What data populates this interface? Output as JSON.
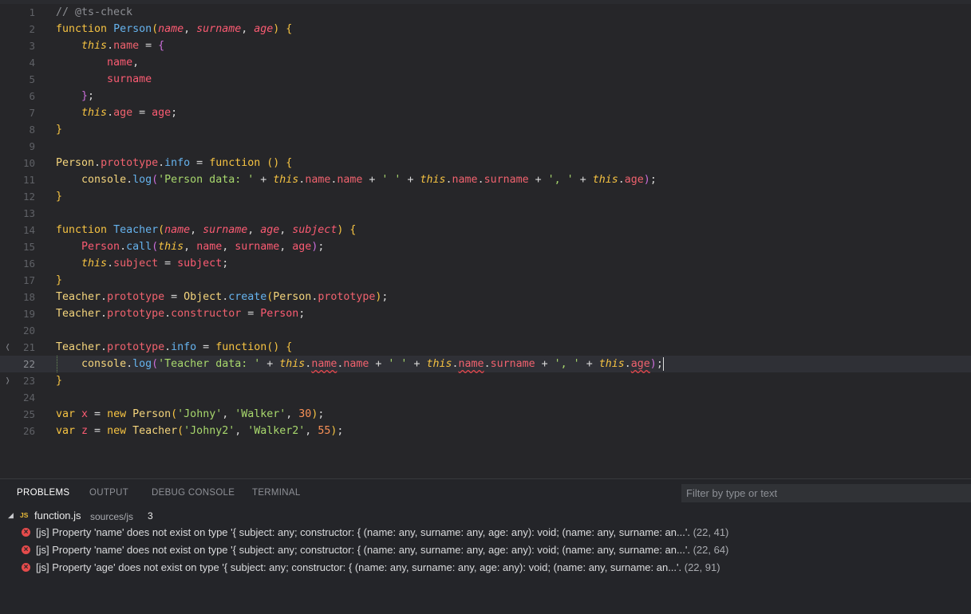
{
  "editor": {
    "lines": [
      {
        "num": "1",
        "tokens": [
          [
            "comment",
            "// @ts-check"
          ]
        ]
      },
      {
        "num": "2",
        "tokens": [
          [
            "kw",
            "function "
          ],
          [
            "fn",
            "Person"
          ],
          [
            "brace",
            "("
          ],
          [
            "param",
            "name"
          ],
          [
            "pun",
            ", "
          ],
          [
            "param",
            "surname"
          ],
          [
            "pun",
            ", "
          ],
          [
            "param",
            "age"
          ],
          [
            "brace",
            ")"
          ],
          [
            "pun",
            " "
          ],
          [
            "brace",
            "{"
          ]
        ]
      },
      {
        "num": "3",
        "tokens": [
          [
            "pun",
            "    "
          ],
          [
            "this",
            "this"
          ],
          [
            "pun",
            "."
          ],
          [
            "prop",
            "name"
          ],
          [
            "pun",
            " = "
          ],
          [
            "brace2",
            "{"
          ]
        ]
      },
      {
        "num": "4",
        "tokens": [
          [
            "pun",
            "        "
          ],
          [
            "var",
            "name"
          ],
          [
            "pun",
            ","
          ]
        ]
      },
      {
        "num": "5",
        "tokens": [
          [
            "pun",
            "        "
          ],
          [
            "var",
            "surname"
          ]
        ]
      },
      {
        "num": "6",
        "tokens": [
          [
            "pun",
            "    "
          ],
          [
            "brace2",
            "}"
          ],
          [
            "pun",
            ";"
          ]
        ]
      },
      {
        "num": "7",
        "tokens": [
          [
            "pun",
            "    "
          ],
          [
            "this",
            "this"
          ],
          [
            "pun",
            "."
          ],
          [
            "prop",
            "age"
          ],
          [
            "pun",
            " = "
          ],
          [
            "var",
            "age"
          ],
          [
            "pun",
            ";"
          ]
        ]
      },
      {
        "num": "8",
        "tokens": [
          [
            "brace",
            "}"
          ]
        ]
      },
      {
        "num": "9",
        "tokens": []
      },
      {
        "num": "10",
        "tokens": [
          [
            "cls",
            "Person"
          ],
          [
            "pun",
            "."
          ],
          [
            "prop",
            "prototype"
          ],
          [
            "pun",
            "."
          ],
          [
            "method",
            "info"
          ],
          [
            "pun",
            " = "
          ],
          [
            "kw",
            "function"
          ],
          [
            "pun",
            " "
          ],
          [
            "brace",
            "()"
          ],
          [
            "pun",
            " "
          ],
          [
            "brace",
            "{"
          ]
        ]
      },
      {
        "num": "11",
        "tokens": [
          [
            "pun",
            "    "
          ],
          [
            "obj",
            "console"
          ],
          [
            "pun",
            "."
          ],
          [
            "method",
            "log"
          ],
          [
            "brace2",
            "("
          ],
          [
            "str",
            "'Person data: '"
          ],
          [
            "pun",
            " + "
          ],
          [
            "this",
            "this"
          ],
          [
            "pun",
            "."
          ],
          [
            "prop",
            "name"
          ],
          [
            "pun",
            "."
          ],
          [
            "prop",
            "name"
          ],
          [
            "pun",
            " + "
          ],
          [
            "str",
            "' '"
          ],
          [
            "pun",
            " + "
          ],
          [
            "this",
            "this"
          ],
          [
            "pun",
            "."
          ],
          [
            "prop",
            "name"
          ],
          [
            "pun",
            "."
          ],
          [
            "prop",
            "surname"
          ],
          [
            "pun",
            " + "
          ],
          [
            "str",
            "', '"
          ],
          [
            "pun",
            " + "
          ],
          [
            "this",
            "this"
          ],
          [
            "pun",
            "."
          ],
          [
            "prop",
            "age"
          ],
          [
            "brace2",
            ")"
          ],
          [
            "pun",
            ";"
          ]
        ]
      },
      {
        "num": "12",
        "tokens": [
          [
            "brace",
            "}"
          ]
        ]
      },
      {
        "num": "13",
        "tokens": []
      },
      {
        "num": "14",
        "tokens": [
          [
            "kw",
            "function "
          ],
          [
            "fn",
            "Teacher"
          ],
          [
            "brace",
            "("
          ],
          [
            "param",
            "name"
          ],
          [
            "pun",
            ", "
          ],
          [
            "param",
            "surname"
          ],
          [
            "pun",
            ", "
          ],
          [
            "param",
            "age"
          ],
          [
            "pun",
            ", "
          ],
          [
            "param",
            "subject"
          ],
          [
            "brace",
            ")"
          ],
          [
            "pun",
            " "
          ],
          [
            "brace",
            "{"
          ]
        ]
      },
      {
        "num": "15",
        "tokens": [
          [
            "pun",
            "    "
          ],
          [
            "var",
            "Person"
          ],
          [
            "pun",
            "."
          ],
          [
            "method",
            "call"
          ],
          [
            "brace2",
            "("
          ],
          [
            "this",
            "this"
          ],
          [
            "pun",
            ", "
          ],
          [
            "var",
            "name"
          ],
          [
            "pun",
            ", "
          ],
          [
            "var",
            "surname"
          ],
          [
            "pun",
            ", "
          ],
          [
            "var",
            "age"
          ],
          [
            "brace2",
            ")"
          ],
          [
            "pun",
            ";"
          ]
        ]
      },
      {
        "num": "16",
        "tokens": [
          [
            "pun",
            "    "
          ],
          [
            "this",
            "this"
          ],
          [
            "pun",
            "."
          ],
          [
            "prop",
            "subject"
          ],
          [
            "pun",
            " = "
          ],
          [
            "var",
            "subject"
          ],
          [
            "pun",
            ";"
          ]
        ]
      },
      {
        "num": "17",
        "tokens": [
          [
            "brace",
            "}"
          ]
        ]
      },
      {
        "num": "18",
        "tokens": [
          [
            "cls",
            "Teacher"
          ],
          [
            "pun",
            "."
          ],
          [
            "prop",
            "prototype"
          ],
          [
            "pun",
            " = "
          ],
          [
            "cls",
            "Object"
          ],
          [
            "pun",
            "."
          ],
          [
            "method",
            "create"
          ],
          [
            "brace",
            "("
          ],
          [
            "cls",
            "Person"
          ],
          [
            "pun",
            "."
          ],
          [
            "prop",
            "prototype"
          ],
          [
            "brace",
            ")"
          ],
          [
            "pun",
            ";"
          ]
        ]
      },
      {
        "num": "19",
        "tokens": [
          [
            "cls",
            "Teacher"
          ],
          [
            "pun",
            "."
          ],
          [
            "prop",
            "prototype"
          ],
          [
            "pun",
            "."
          ],
          [
            "prop",
            "constructor"
          ],
          [
            "pun",
            " = "
          ],
          [
            "var",
            "Person"
          ],
          [
            "pun",
            ";"
          ]
        ]
      },
      {
        "num": "20",
        "tokens": []
      },
      {
        "num": "21",
        "tokens": [
          [
            "cls",
            "Teacher"
          ],
          [
            "pun",
            "."
          ],
          [
            "prop",
            "prototype"
          ],
          [
            "pun",
            "."
          ],
          [
            "method",
            "info"
          ],
          [
            "pun",
            " = "
          ],
          [
            "kw",
            "function"
          ],
          [
            "brace",
            "()"
          ],
          [
            "pun",
            " "
          ],
          [
            "brace",
            "{"
          ]
        ]
      },
      {
        "num": "22",
        "tokens": [
          [
            "pun",
            "    "
          ],
          [
            "obj",
            "console"
          ],
          [
            "pun",
            "."
          ],
          [
            "method",
            "log"
          ],
          [
            "brace2",
            "("
          ],
          [
            "str",
            "'Teacher data: '"
          ],
          [
            "pun",
            " + "
          ],
          [
            "this",
            "this"
          ],
          [
            "pun",
            "."
          ],
          [
            "prop squig",
            "name"
          ],
          [
            "pun",
            "."
          ],
          [
            "prop",
            "name"
          ],
          [
            "pun",
            " + "
          ],
          [
            "str",
            "' '"
          ],
          [
            "pun",
            " + "
          ],
          [
            "this",
            "this"
          ],
          [
            "pun",
            "."
          ],
          [
            "prop squig",
            "name"
          ],
          [
            "pun",
            "."
          ],
          [
            "prop",
            "surname"
          ],
          [
            "pun",
            " + "
          ],
          [
            "str",
            "', '"
          ],
          [
            "pun",
            " + "
          ],
          [
            "this",
            "this"
          ],
          [
            "pun",
            "."
          ],
          [
            "prop squig",
            "age"
          ],
          [
            "brace2",
            ")"
          ],
          [
            "pun",
            ";"
          ]
        ]
      },
      {
        "num": "23",
        "tokens": [
          [
            "brace",
            "}"
          ]
        ]
      },
      {
        "num": "24",
        "tokens": []
      },
      {
        "num": "25",
        "tokens": [
          [
            "kw",
            "var "
          ],
          [
            "var",
            "x"
          ],
          [
            "pun",
            " = "
          ],
          [
            "kw",
            "new "
          ],
          [
            "cls",
            "Person"
          ],
          [
            "brace",
            "("
          ],
          [
            "str",
            "'Johny'"
          ],
          [
            "pun",
            ", "
          ],
          [
            "str",
            "'Walker'"
          ],
          [
            "pun",
            ", "
          ],
          [
            "num",
            "30"
          ],
          [
            "brace",
            ")"
          ],
          [
            "pun",
            ";"
          ]
        ]
      },
      {
        "num": "26",
        "tokens": [
          [
            "kw",
            "var "
          ],
          [
            "var",
            "z"
          ],
          [
            "pun",
            " = "
          ],
          [
            "kw",
            "new "
          ],
          [
            "cls",
            "Teacher"
          ],
          [
            "brace",
            "("
          ],
          [
            "str",
            "'Johny2'"
          ],
          [
            "pun",
            ", "
          ],
          [
            "str",
            "'Walker2'"
          ],
          [
            "pun",
            ", "
          ],
          [
            "num",
            "55"
          ],
          [
            "brace",
            ")"
          ],
          [
            "pun",
            ";"
          ]
        ]
      }
    ],
    "current_line": "22",
    "fold_marks": {
      "21": "❬",
      "23": "❭"
    }
  },
  "panel": {
    "tabs": [
      {
        "label": "PROBLEMS",
        "active": true
      },
      {
        "label": "OUTPUT",
        "active": false
      },
      {
        "label": "DEBUG CONSOLE",
        "active": false
      },
      {
        "label": "TERMINAL",
        "active": false
      }
    ],
    "filter_placeholder": "Filter by type or text",
    "file_group": {
      "chevron_icon": "chevron-down-icon",
      "lang_badge": "JS",
      "filename": "function.js",
      "path": "sources/js",
      "count": "3"
    },
    "problems": [
      {
        "icon": "error-icon",
        "message": "[js] Property 'name' does not exist on type '{ subject: any; constructor: { (name: any, surname: any, age: any): void; (name: any, surname: an...'.",
        "position": "(22, 41)"
      },
      {
        "icon": "error-icon",
        "message": "[js] Property 'name' does not exist on type '{ subject: any; constructor: { (name: any, surname: any, age: any): void; (name: any, surname: an...'.",
        "position": "(22, 64)"
      },
      {
        "icon": "error-icon",
        "message": "[js] Property 'age' does not exist on type '{ subject: any; constructor: { (name: any, surname: any, age: any): void; (name: any, surname: an...'.",
        "position": "(22, 91)"
      }
    ]
  }
}
